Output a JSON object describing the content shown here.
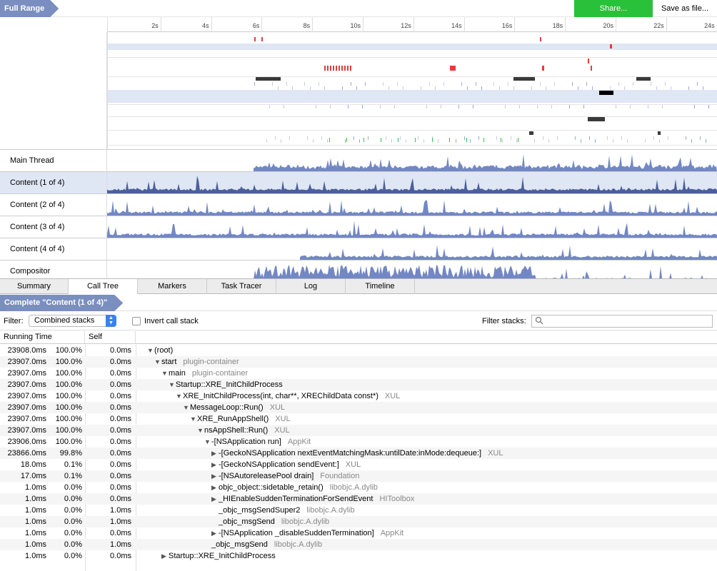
{
  "topbar": {
    "crumb": "Full Range",
    "share": "Share...",
    "save": "Save as file..."
  },
  "ruler_ticks": [
    "2s",
    "4s",
    "6s",
    "8s",
    "10s",
    "12s",
    "14s",
    "16s",
    "18s",
    "20s",
    "22s",
    "24s"
  ],
  "threads": [
    {
      "label": "Main Thread",
      "selected": false
    },
    {
      "label": "Content (1 of 4)",
      "selected": true
    },
    {
      "label": "Content (2 of 4)",
      "selected": false
    },
    {
      "label": "Content (3 of 4)",
      "selected": false
    },
    {
      "label": "Content (4 of 4)",
      "selected": false
    },
    {
      "label": "Compositor",
      "selected": false
    }
  ],
  "tabs": [
    {
      "label": "Summary",
      "active": false
    },
    {
      "label": "Call Tree",
      "active": true
    },
    {
      "label": "Markers",
      "active": false
    },
    {
      "label": "Task Tracer",
      "active": false
    },
    {
      "label": "Log",
      "active": false
    },
    {
      "label": "Timeline",
      "active": false
    }
  ],
  "selection_crumb": "Complete \"Content (1 of 4)\"",
  "filter": {
    "label": "Filter:",
    "selected": "Combined stacks",
    "invert_label": "Invert call stack",
    "invert_checked": false,
    "stacks_label": "Filter stacks:",
    "stacks_value": ""
  },
  "tree_header": {
    "running_time": "Running Time",
    "self": "Self"
  },
  "tree_rows": [
    {
      "time": "23908.0ms",
      "pct": "100.0%",
      "self": "0.0ms",
      "depth": 0,
      "twisty": "open",
      "name": "(root)",
      "lib": ""
    },
    {
      "time": "23907.0ms",
      "pct": "100.0%",
      "self": "0.0ms",
      "depth": 1,
      "twisty": "open",
      "name": "start",
      "lib": "plugin-container"
    },
    {
      "time": "23907.0ms",
      "pct": "100.0%",
      "self": "0.0ms",
      "depth": 2,
      "twisty": "open",
      "name": "main",
      "lib": "plugin-container"
    },
    {
      "time": "23907.0ms",
      "pct": "100.0%",
      "self": "0.0ms",
      "depth": 3,
      "twisty": "open",
      "name": "Startup::XRE_InitChildProcess",
      "lib": ""
    },
    {
      "time": "23907.0ms",
      "pct": "100.0%",
      "self": "0.0ms",
      "depth": 4,
      "twisty": "open",
      "name": "XRE_InitChildProcess(int, char**, XREChildData const*)",
      "lib": "XUL"
    },
    {
      "time": "23907.0ms",
      "pct": "100.0%",
      "self": "0.0ms",
      "depth": 5,
      "twisty": "open",
      "name": "MessageLoop::Run()",
      "lib": "XUL"
    },
    {
      "time": "23907.0ms",
      "pct": "100.0%",
      "self": "0.0ms",
      "depth": 6,
      "twisty": "open",
      "name": "XRE_RunAppShell()",
      "lib": "XUL"
    },
    {
      "time": "23907.0ms",
      "pct": "100.0%",
      "self": "0.0ms",
      "depth": 7,
      "twisty": "open",
      "name": "nsAppShell::Run()",
      "lib": "XUL"
    },
    {
      "time": "23906.0ms",
      "pct": "100.0%",
      "self": "0.0ms",
      "depth": 8,
      "twisty": "open",
      "name": "-[NSApplication run]",
      "lib": "AppKit"
    },
    {
      "time": "23866.0ms",
      "pct": "99.8%",
      "self": "0.0ms",
      "depth": 9,
      "twisty": "closed",
      "name": "-[GeckoNSApplication nextEventMatchingMask:untilDate:inMode:dequeue:]",
      "lib": "XUL"
    },
    {
      "time": "18.0ms",
      "pct": "0.1%",
      "self": "0.0ms",
      "depth": 9,
      "twisty": "closed",
      "name": "-[GeckoNSApplication sendEvent:]",
      "lib": "XUL"
    },
    {
      "time": "17.0ms",
      "pct": "0.1%",
      "self": "0.0ms",
      "depth": 9,
      "twisty": "closed",
      "name": "-[NSAutoreleasePool drain]",
      "lib": "Foundation"
    },
    {
      "time": "1.0ms",
      "pct": "0.0%",
      "self": "0.0ms",
      "depth": 9,
      "twisty": "closed",
      "name": "objc_object::sidetable_retain()",
      "lib": "libobjc.A.dylib"
    },
    {
      "time": "1.0ms",
      "pct": "0.0%",
      "self": "0.0ms",
      "depth": 9,
      "twisty": "closed",
      "name": "_HIEnableSuddenTerminationForSendEvent",
      "lib": "HIToolbox"
    },
    {
      "time": "1.0ms",
      "pct": "0.0%",
      "self": "1.0ms",
      "depth": 9,
      "twisty": "none",
      "name": "_objc_msgSendSuper2",
      "lib": "libobjc.A.dylib"
    },
    {
      "time": "1.0ms",
      "pct": "0.0%",
      "self": "1.0ms",
      "depth": 9,
      "twisty": "none",
      "name": "_objc_msgSend",
      "lib": "libobjc.A.dylib"
    },
    {
      "time": "1.0ms",
      "pct": "0.0%",
      "self": "0.0ms",
      "depth": 9,
      "twisty": "closed",
      "name": "-[NSApplication _disableSuddenTermination]",
      "lib": "AppKit"
    },
    {
      "time": "1.0ms",
      "pct": "0.0%",
      "self": "1.0ms",
      "depth": 8,
      "twisty": "none",
      "name": "_objc_msgSend",
      "lib": "libobjc.A.dylib"
    },
    {
      "time": "1.0ms",
      "pct": "0.0%",
      "self": "0.0ms",
      "depth": 2,
      "twisty": "closed",
      "name": "Startup::XRE_InitChildProcess",
      "lib": ""
    }
  ],
  "colors": {
    "accent": "#7a8ec0",
    "graph": "#7287c4",
    "share": "#2ac13a",
    "marker_red": "#e23b3b",
    "marker_dark": "#3a3a3a"
  }
}
